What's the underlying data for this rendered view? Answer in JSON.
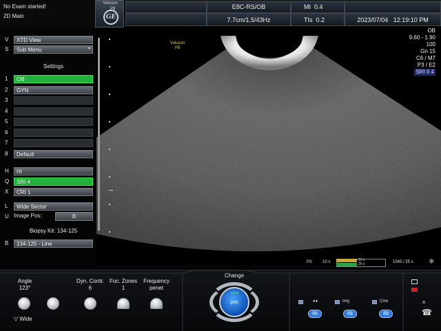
{
  "status": {
    "message": "No Exam started!",
    "mode": "2D Main"
  },
  "brand": {
    "name": "Voluson",
    "probe": "P8",
    "logo_text": "GE"
  },
  "header": {
    "preset": "E8C-RS/OB",
    "depth_freq": "7.7cm/1.5/43Hz",
    "mi_label": "MI",
    "mi_value": "0.4",
    "tis_label": "TIs",
    "tis_value": "0.2",
    "date": "2023/07/04",
    "time": "12:19:10 PM"
  },
  "left_menu": {
    "top_items": [
      {
        "key": "V",
        "label": "XTD View"
      },
      {
        "key": "S",
        "label": "Sub Menu"
      }
    ],
    "settings_title": "Settings",
    "settings": [
      {
        "key": "1",
        "label": "OB",
        "state": "active"
      },
      {
        "key": "2",
        "label": "GYN",
        "state": "normal"
      },
      {
        "key": "3",
        "label": "",
        "state": "empty"
      },
      {
        "key": "4",
        "label": "",
        "state": "empty"
      },
      {
        "key": "5",
        "label": "",
        "state": "empty"
      },
      {
        "key": "6",
        "label": "",
        "state": "empty"
      },
      {
        "key": "7",
        "label": "",
        "state": "empty"
      },
      {
        "key": "8",
        "label": "Default",
        "state": "normal"
      }
    ],
    "filter_items": [
      {
        "key": "H",
        "label": "HI",
        "state": "normal"
      },
      {
        "key": "Q",
        "label": "SRI 4",
        "state": "active"
      },
      {
        "key": "X",
        "label": "CRI 1",
        "state": "normal"
      }
    ],
    "sector": {
      "key": "L",
      "label": "Wide Sector"
    },
    "image_pos": {
      "key": "U",
      "label": "Image Pos:",
      "value": "B"
    },
    "biopsy_title": "Biopsy Kit: 134-125",
    "biopsy": {
      "key": "B",
      "label": "134-125 - Line"
    }
  },
  "image": {
    "probe_overlay_name": "Voluson",
    "probe_overlay_id": "P8"
  },
  "right_info": [
    "OB",
    "9.60 - 1.90",
    "100",
    "Gn 15",
    "C6 / M7",
    "P3 / E2",
    "SRI II 4"
  ],
  "cine": {
    "probe": "P3",
    "duration": "10 s",
    "bar_top": "10 s",
    "bar_bottom": "25 s",
    "count": "1045 / 25 s",
    "fill_fraction": 0.42
  },
  "bottom_controls": {
    "knobs": [
      {
        "label": "Angle",
        "value": "123°"
      },
      {
        "label": "",
        "value": ""
      },
      {
        "label": "Dyn. Contr.",
        "value": "6"
      },
      {
        "label": "Foc. Zones",
        "value": "1"
      },
      {
        "label": "Frequency",
        "value": "penet"
      }
    ],
    "wide_label": "▽ Wide",
    "change_label": "Change",
    "pos_label": "pos",
    "p_buttons": [
      {
        "icon_label": "",
        "label": "P1"
      },
      {
        "icon_label": "Img",
        "label": "P2"
      },
      {
        "icon_label": "Cine",
        "label": "P3"
      }
    ],
    "a_label": "a"
  }
}
